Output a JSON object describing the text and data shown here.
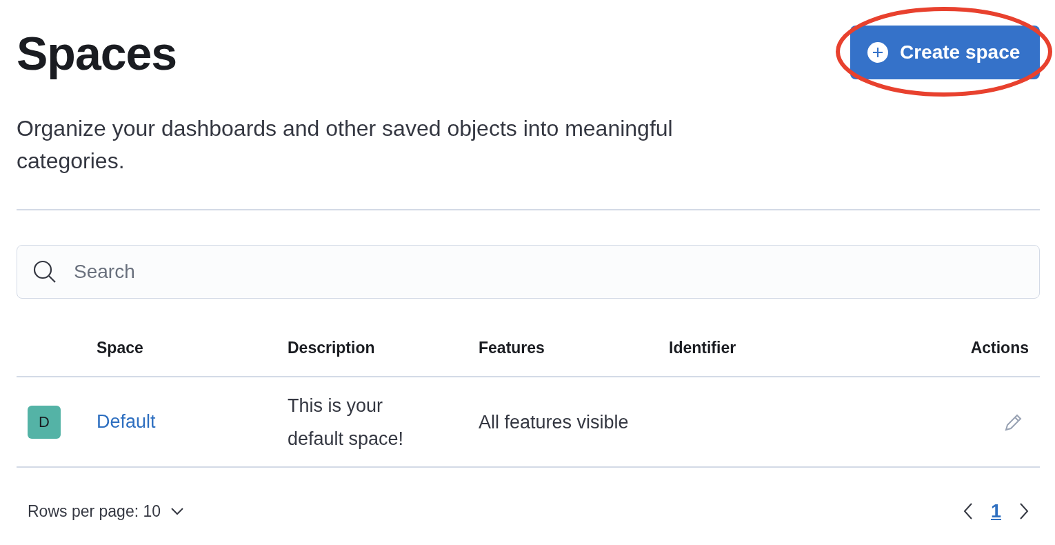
{
  "header": {
    "title": "Spaces",
    "create_button": "Create space",
    "highlighted": true
  },
  "description": "Organize your dashboards and other saved objects into meaningful categories.",
  "search": {
    "placeholder": "Search"
  },
  "table": {
    "columns": [
      "Space",
      "Description",
      "Features",
      "Identifier",
      "Actions"
    ],
    "rows": [
      {
        "avatar": "D",
        "name": "Default",
        "description": "This is your default space!",
        "features": "All features visible"
      }
    ]
  },
  "pagination": {
    "rows_per_page": "Rows per page: 10",
    "pages": [
      {
        "label": "1",
        "selected": true
      }
    ]
  }
}
